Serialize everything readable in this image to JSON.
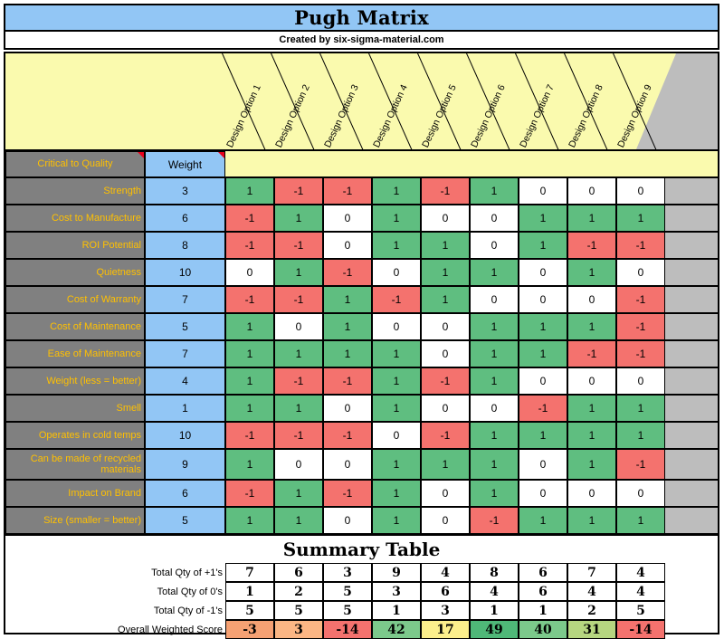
{
  "header": {
    "title": "Pugh Matrix",
    "credit": "Created by six-sigma-material.com"
  },
  "colors": {
    "title_bg": "#92C6F5",
    "header_yellow": "#FAFAAE",
    "row_label_bg": "#808080",
    "row_label_text": "#FFC000",
    "positive": "#5FBE80",
    "negative": "#F4726E",
    "zero": "#FFFFFF",
    "gray_panel": "#BDBDBD",
    "comment_flag": "#E8001C"
  },
  "columns": {
    "ctq_header": "Critical to Quality",
    "weight_header": "Weight",
    "options": [
      "Design Option 1",
      "Design Option 2",
      "Design Option 3",
      "Design Option 4",
      "Design Option 5",
      "Design Option 6",
      "Design Option 7",
      "Design Option 8",
      "Design Option 9"
    ]
  },
  "rows": [
    {
      "criteria": "Strength",
      "weight": 3,
      "scores": [
        1,
        -1,
        -1,
        1,
        -1,
        1,
        0,
        0,
        0
      ]
    },
    {
      "criteria": "Cost to Manufacture",
      "weight": 6,
      "scores": [
        -1,
        1,
        0,
        1,
        0,
        0,
        1,
        1,
        1
      ]
    },
    {
      "criteria": "ROI Potential",
      "weight": 8,
      "scores": [
        -1,
        -1,
        0,
        1,
        1,
        0,
        1,
        -1,
        -1
      ]
    },
    {
      "criteria": "Quietness",
      "weight": 10,
      "scores": [
        0,
        1,
        -1,
        0,
        1,
        1,
        0,
        1,
        0
      ]
    },
    {
      "criteria": "Cost of Warranty",
      "weight": 7,
      "scores": [
        -1,
        -1,
        1,
        -1,
        1,
        0,
        0,
        0,
        -1
      ]
    },
    {
      "criteria": "Cost of Maintenance",
      "weight": 5,
      "scores": [
        1,
        0,
        1,
        0,
        0,
        1,
        1,
        1,
        -1
      ]
    },
    {
      "criteria": "Ease of Maintenance",
      "weight": 7,
      "scores": [
        1,
        1,
        1,
        1,
        0,
        1,
        1,
        -1,
        -1
      ]
    },
    {
      "criteria": "Weight (less = better)",
      "weight": 4,
      "scores": [
        1,
        -1,
        -1,
        1,
        -1,
        1,
        0,
        0,
        0
      ]
    },
    {
      "criteria": "Smell",
      "weight": 1,
      "scores": [
        1,
        1,
        0,
        1,
        0,
        0,
        -1,
        1,
        1
      ]
    },
    {
      "criteria": "Operates in cold temps",
      "weight": 10,
      "scores": [
        -1,
        -1,
        -1,
        0,
        -1,
        1,
        1,
        1,
        1
      ]
    },
    {
      "criteria": "Can be made of recycled materials",
      "weight": 9,
      "scores": [
        1,
        0,
        0,
        1,
        1,
        1,
        0,
        1,
        -1
      ]
    },
    {
      "criteria": "Impact on Brand",
      "weight": 6,
      "scores": [
        -1,
        1,
        -1,
        1,
        0,
        1,
        0,
        0,
        0
      ]
    },
    {
      "criteria": "Size (smaller = better)",
      "weight": 5,
      "scores": [
        1,
        1,
        0,
        1,
        0,
        -1,
        1,
        1,
        1
      ]
    }
  ],
  "summary": {
    "title": "Summary Table",
    "labels": {
      "plus_ones": "Total Qty of +1's",
      "zeros": "Total Qty of 0's",
      "minus_ones": "Total Qty of -1's",
      "overall": "Overall Weighted Score"
    },
    "plus_ones": [
      7,
      6,
      3,
      9,
      4,
      8,
      6,
      7,
      4
    ],
    "zeros": [
      1,
      2,
      5,
      3,
      6,
      4,
      6,
      4,
      4
    ],
    "minus_ones": [
      5,
      5,
      5,
      1,
      3,
      1,
      1,
      2,
      5
    ],
    "overall": [
      -3,
      3,
      -14,
      42,
      17,
      49,
      40,
      31,
      -14
    ],
    "overall_colors": [
      "#F6A173",
      "#FBB684",
      "#F4726E",
      "#7CC98B",
      "#FCEF8C",
      "#4FB878",
      "#7CC98B",
      "#B6D680",
      "#F4726E"
    ]
  }
}
